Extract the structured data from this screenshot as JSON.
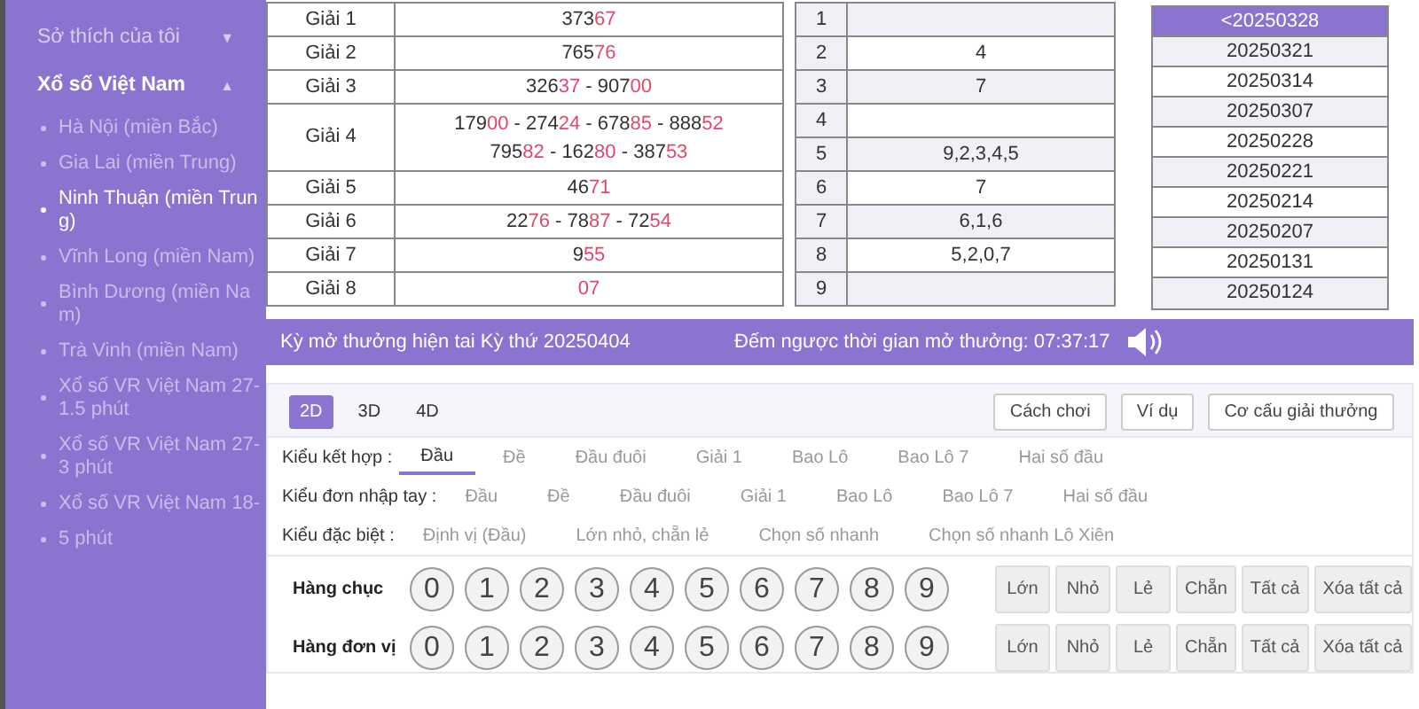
{
  "sidebar": {
    "groups": [
      {
        "label": "Sở thích của tôi",
        "caret": "▼",
        "expanded": false
      },
      {
        "label": "Xổ số Việt Nam",
        "caret": "▲",
        "expanded": true,
        "items": [
          {
            "label": "Hà Nội (miền Bắc)",
            "selected": false
          },
          {
            "label": "Gia Lai (miền Trung)",
            "selected": false
          },
          {
            "label": "Ninh Thuận (miền Trung)",
            "selected": true
          },
          {
            "label": "Vĩnh Long (miền Nam)",
            "selected": false
          },
          {
            "label": "Bình Dương (miền Nam)",
            "selected": false
          },
          {
            "label": "Trà Vinh (miền Nam)",
            "selected": false
          },
          {
            "label": "Xổ số VR Việt Nam 27-1.5 phút",
            "selected": false
          },
          {
            "label": "Xổ số VR Việt Nam 27-3 phút",
            "selected": false
          },
          {
            "label": "Xổ số VR Việt Nam 18-",
            "selected": false
          },
          {
            "label": "5 phút",
            "selected": false
          }
        ]
      }
    ]
  },
  "results": {
    "separator": " - ",
    "rows": [
      {
        "prize": "Giải 1",
        "lines": [
          [
            "37367"
          ]
        ]
      },
      {
        "prize": "Giải 2",
        "lines": [
          [
            "76576"
          ]
        ]
      },
      {
        "prize": "Giải 3",
        "lines": [
          [
            "32637",
            "90700"
          ]
        ]
      },
      {
        "prize": "Giải 4",
        "lines": [
          [
            "17900",
            "27424",
            "67885",
            "88852"
          ],
          [
            "79582",
            "16280",
            "38753"
          ]
        ]
      },
      {
        "prize": "Giải 5",
        "lines": [
          [
            "4671"
          ]
        ]
      },
      {
        "prize": "Giải 6",
        "lines": [
          [
            "2276",
            "7887",
            "7254"
          ]
        ]
      },
      {
        "prize": "Giải 7",
        "lines": [
          [
            "955"
          ]
        ]
      },
      {
        "prize": "Giải 8",
        "lines": [
          [
            "07"
          ]
        ]
      }
    ]
  },
  "digits_table": {
    "rows": [
      {
        "digit": "1"
      },
      {
        "digit": "2",
        "values": "4"
      },
      {
        "digit": "3",
        "values": "7"
      },
      {
        "digit": "4"
      },
      {
        "digit": "5",
        "values": "9,2,3,4,5"
      },
      {
        "digit": "6",
        "values": "7"
      },
      {
        "digit": "7",
        "values": "6,1,6"
      },
      {
        "digit": "8",
        "values": "5,2,0,7"
      },
      {
        "digit": "9"
      }
    ]
  },
  "draw_list": {
    "items": [
      {
        "label": "<20250328",
        "selected": true
      },
      {
        "label": "20250321",
        "selected": false
      },
      {
        "label": "20250314",
        "selected": false
      },
      {
        "label": "20250307",
        "selected": false
      },
      {
        "label": "20250228",
        "selected": false
      },
      {
        "label": "20250221",
        "selected": false
      },
      {
        "label": "20250214",
        "selected": false
      },
      {
        "label": "20250207",
        "selected": false
      },
      {
        "label": "20250131",
        "selected": false
      },
      {
        "label": "20250124",
        "selected": false
      }
    ]
  },
  "banner": {
    "current": "Kỳ mở thưởng hiện tai Kỳ thứ 20250404",
    "countdown": "Đếm ngược thời gian mở thưởng: 07:37:17"
  },
  "game": {
    "tabs": [
      {
        "label": "2D",
        "selected": true
      },
      {
        "label": "3D",
        "selected": false
      },
      {
        "label": "4D",
        "selected": false
      }
    ],
    "buttons": [
      "Cách chơi",
      "Ví dụ",
      "Cơ cấu giải thưởng"
    ],
    "modes": [
      {
        "label": "Kiểu kết hợp :",
        "options": [
          {
            "label": "Đầu",
            "selected": true
          },
          {
            "label": "Đề",
            "selected": false
          },
          {
            "label": "Đầu đuôi",
            "selected": false
          },
          {
            "label": "Giải 1",
            "selected": false
          },
          {
            "label": "Bao Lô",
            "selected": false
          },
          {
            "label": "Bao Lô 7",
            "selected": false
          },
          {
            "label": "Hai số đầu",
            "selected": false
          }
        ]
      },
      {
        "label": "Kiểu đơn nhập tay :",
        "options": [
          {
            "label": "Đầu",
            "selected": false
          },
          {
            "label": "Đề",
            "selected": false
          },
          {
            "label": "Đầu đuôi",
            "selected": false
          },
          {
            "label": "Giải 1",
            "selected": false
          },
          {
            "label": "Bao Lô",
            "selected": false
          },
          {
            "label": "Bao Lô 7",
            "selected": false
          },
          {
            "label": "Hai số đầu",
            "selected": false
          }
        ]
      },
      {
        "label": "Kiểu đặc biệt :",
        "options": [
          {
            "label": "Định vị (Đầu)",
            "selected": false
          },
          {
            "label": "Lớn nhỏ, chẵn lẻ",
            "selected": false
          },
          {
            "label": "Chọn số nhanh",
            "selected": false
          },
          {
            "label": "Chọn số nhanh Lô Xiên",
            "selected": false
          }
        ]
      }
    ],
    "pickers": [
      {
        "label": "Hàng chục",
        "digits": [
          "0",
          "1",
          "2",
          "3",
          "4",
          "5",
          "6",
          "7",
          "8",
          "9"
        ],
        "actions": [
          "Lớn",
          "Nhỏ",
          "Lẻ",
          "Chẵn",
          "Tất cả",
          "Xóa tất cả"
        ]
      },
      {
        "label": "Hàng đơn vị",
        "digits": [
          "0",
          "1",
          "2",
          "3",
          "4",
          "5",
          "6",
          "7",
          "8",
          "9"
        ],
        "actions": [
          "Lớn",
          "Nhỏ",
          "Lẻ",
          "Chẵn",
          "Tất cả",
          "Xóa tất cả"
        ]
      }
    ]
  }
}
